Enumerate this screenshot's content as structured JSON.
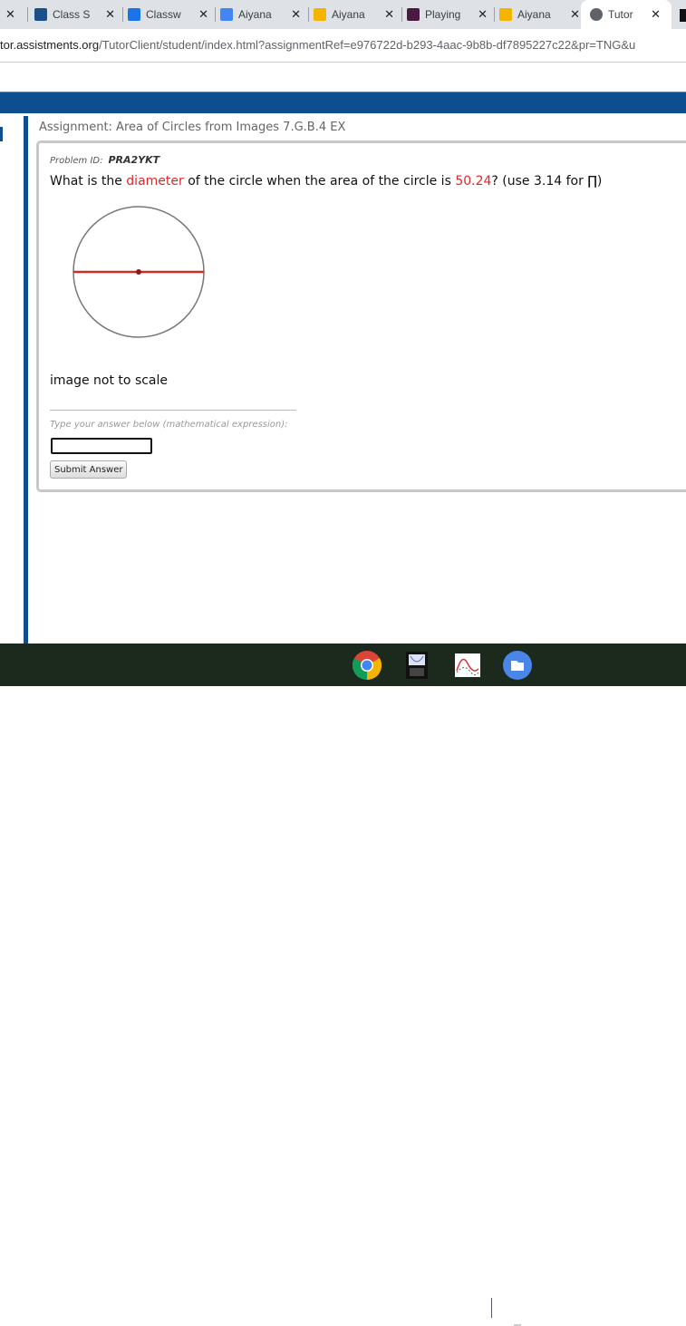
{
  "browser": {
    "tabs": [
      {
        "label": "Class S",
        "icon": "powerschool-icon",
        "color": "#1a4f8b"
      },
      {
        "label": "Classw",
        "icon": "classroom-icon",
        "color": "#1a73e8"
      },
      {
        "label": "Aiyana",
        "icon": "docs-icon",
        "color": "#4285f4"
      },
      {
        "label": "Aiyana",
        "icon": "slides-icon",
        "color": "#f4b400"
      },
      {
        "label": "Playing",
        "icon": "quizlet-icon",
        "color": "#4a1942"
      },
      {
        "label": "Aiyana",
        "icon": "slides-icon",
        "color": "#f4b400"
      },
      {
        "label": "Tutor",
        "icon": "globe-icon",
        "color": "#5f6368",
        "active": true
      }
    ],
    "url_host": "tor.assistments.org",
    "url_path": "/TutorClient/student/index.html?assignmentRef=e976722d-b293-4aac-9b8b-df7895227c22&pr=TNG&u"
  },
  "assignment": {
    "title": "Assignment: Area of Circles from Images 7.G.B.4 EX"
  },
  "problem": {
    "id_label": "Problem ID:",
    "id": "PRA2YKT",
    "q1": "What is the ",
    "q_term": "diameter",
    "q2": " of the circle when the area of the circle is ",
    "q_value": "50.24",
    "q3": "? (use 3.14 for ∏)",
    "note": "image not to scale",
    "hint": "Type your answer below (mathematical expression):",
    "answer": "",
    "submit_label": "Submit Answer"
  },
  "colors": {
    "accent": "#0d4f8e",
    "highlight": "#e0262a"
  },
  "taskbar": {
    "apps": [
      "chrome-icon",
      "calculator-icon",
      "graph-icon",
      "files-icon"
    ]
  }
}
